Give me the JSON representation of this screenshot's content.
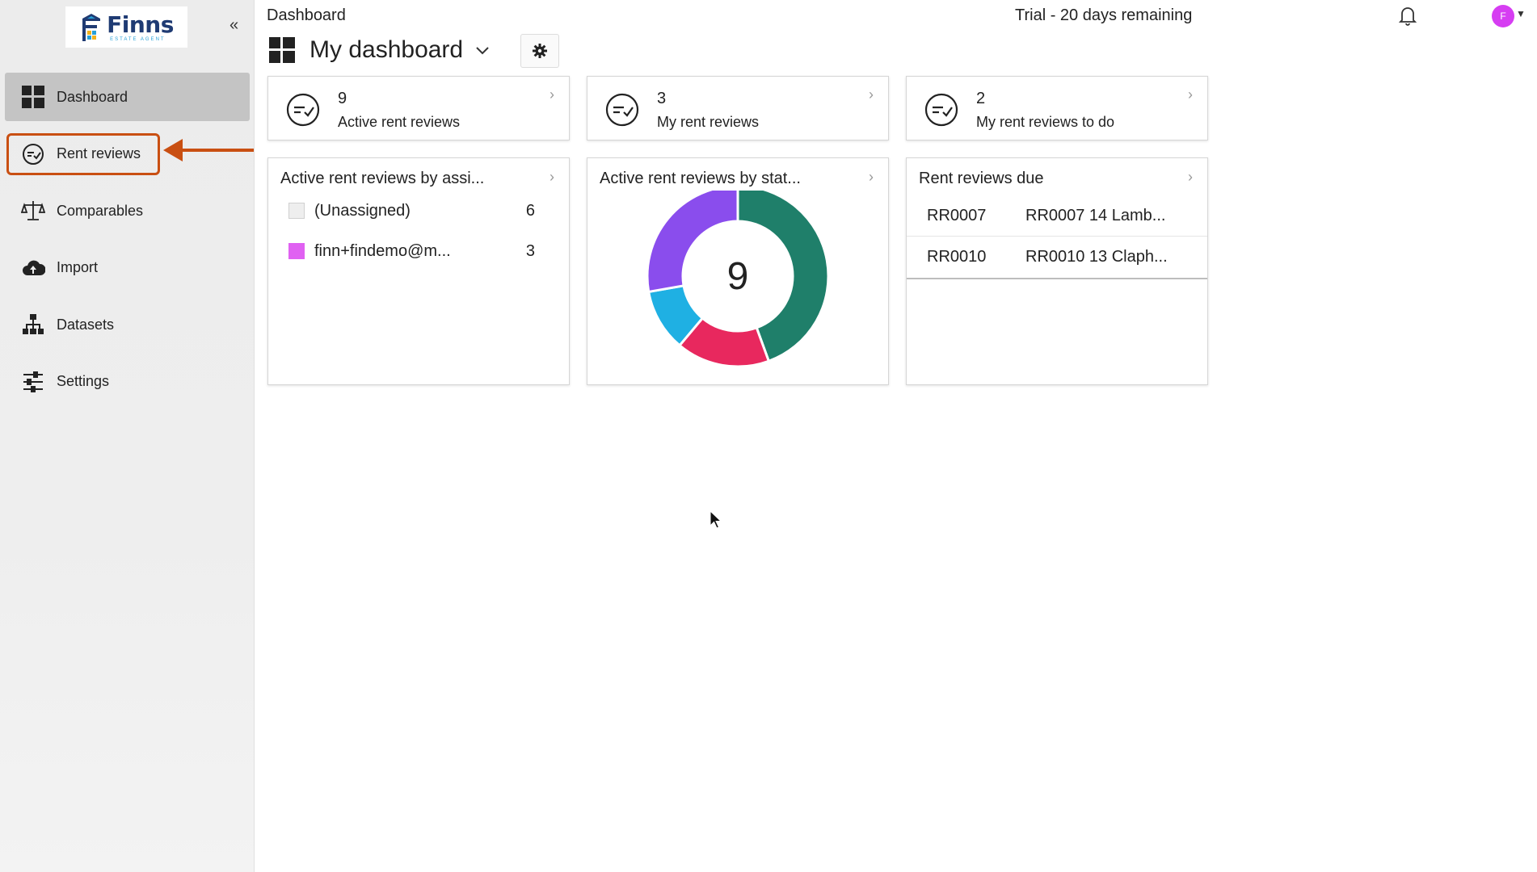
{
  "app": {
    "logo_text": "Finns",
    "logo_subtext": "ESTATE AGENT",
    "collapse_label": "«"
  },
  "sidebar": {
    "items": [
      {
        "label": "Dashboard",
        "icon": "dashboard-grid-icon",
        "active": true
      },
      {
        "label": "Rent reviews",
        "icon": "rent-review-icon",
        "highlighted": true
      },
      {
        "label": "Comparables",
        "icon": "scales-icon"
      },
      {
        "label": "Import",
        "icon": "cloud-upload-icon"
      },
      {
        "label": "Datasets",
        "icon": "hierarchy-icon"
      },
      {
        "label": "Settings",
        "icon": "sliders-icon"
      }
    ]
  },
  "header": {
    "breadcrumb": "Dashboard",
    "trial_text": "Trial - 20 days remaining",
    "avatar_initial": "F"
  },
  "dashboard": {
    "title": "My dashboard",
    "stats": [
      {
        "value": "9",
        "label": "Active rent reviews"
      },
      {
        "value": "3",
        "label": "My rent reviews"
      },
      {
        "value": "2",
        "label": "My rent reviews to do"
      }
    ],
    "by_assignee": {
      "title": "Active rent reviews by assi...",
      "rows": [
        {
          "label": "(Unassigned)",
          "count": "6",
          "color": "#eeeeee"
        },
        {
          "label": "finn+findemo@m...",
          "count": "3",
          "color": "#e061f2"
        }
      ]
    },
    "by_status": {
      "title": "Active rent reviews by stat...",
      "total": "9"
    },
    "due": {
      "title": "Rent reviews due",
      "rows": [
        {
          "ref": "RR0007",
          "name": "RR0007 14 Lamb..."
        },
        {
          "ref": "RR0010",
          "name": "RR0010 13 Claph..."
        }
      ]
    }
  },
  "chart_data": {
    "type": "pie",
    "title": "Active rent reviews by stat...",
    "center_label": "9",
    "values": [
      4,
      1.5,
      1,
      2.5
    ],
    "colors": [
      "#1f7f6a",
      "#e8285e",
      "#1fb0e3",
      "#8a4ded"
    ]
  },
  "colors": {
    "accent_orange": "#c94f12",
    "brand_navy": "#1f3b73"
  }
}
